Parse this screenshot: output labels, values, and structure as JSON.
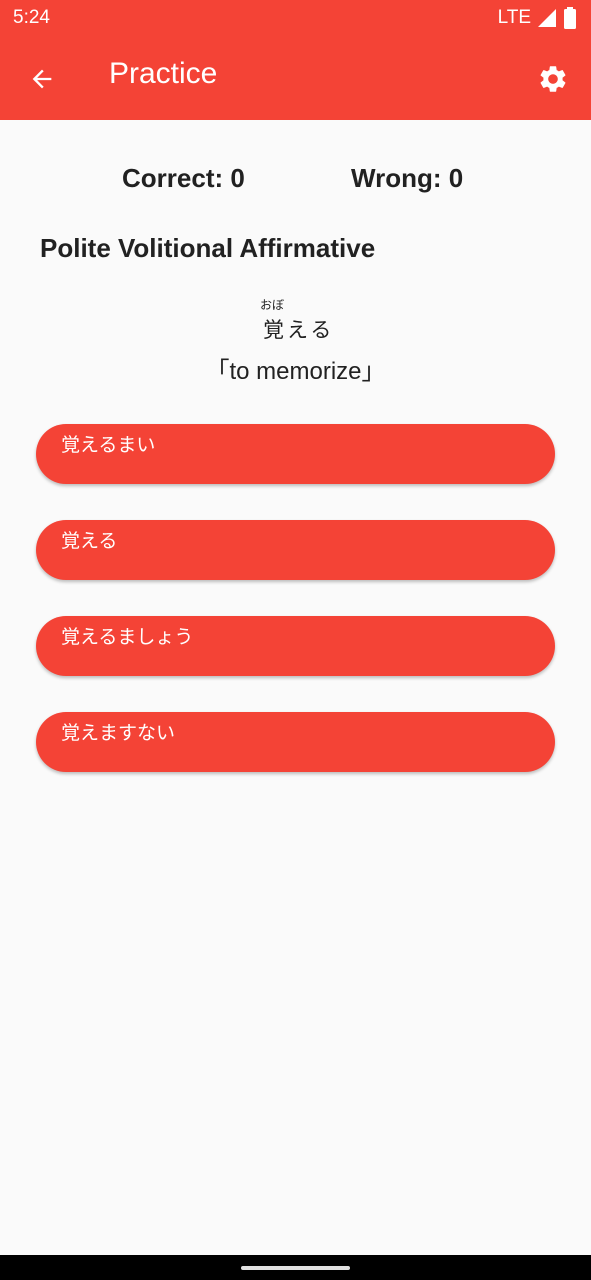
{
  "status_bar": {
    "time": "5:24",
    "network": "LTE",
    "icons": [
      "signal-icon",
      "battery-icon"
    ]
  },
  "app_bar": {
    "title": "Practice",
    "back_icon": "arrow-back-icon",
    "settings_icon": "gear-icon"
  },
  "score": {
    "correct": "Correct: 0",
    "wrong": "Wrong: 0"
  },
  "question": {
    "form": "Polite Volitional Affirmative",
    "furigana": "おぼ",
    "word": "覚える",
    "meaning": "「to memorize」"
  },
  "answers": [
    "覚えるまい",
    "覚える",
    "覚えるましょう",
    "覚えますない"
  ],
  "colors": {
    "primary": "#f44336",
    "background": "#fafafa",
    "text": "#212121"
  }
}
